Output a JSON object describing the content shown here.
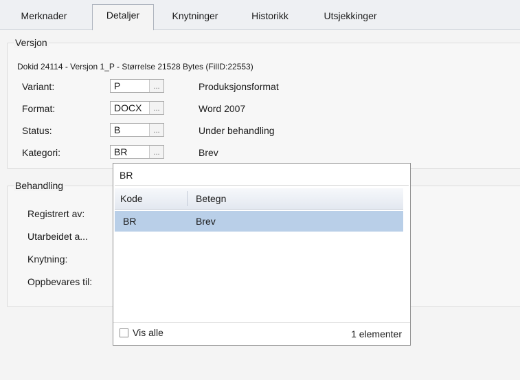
{
  "tabs": [
    {
      "label": "Merknader"
    },
    {
      "label": "Detaljer"
    },
    {
      "label": "Knytninger"
    },
    {
      "label": "Historikk"
    },
    {
      "label": "Utsjekkinger"
    }
  ],
  "versjon": {
    "title": "Versjon",
    "caption": "Dokid 24114 - Versjon 1_P - Størrelse 21528 Bytes (FilID:22553)",
    "fields": [
      {
        "label": "Variant:",
        "value": "P",
        "button": "...",
        "description": "Produksjonsformat"
      },
      {
        "label": "Format:",
        "value": "DOCX",
        "button": "...",
        "description": "Word 2007"
      },
      {
        "label": "Status:",
        "value": "B",
        "button": "...",
        "description": "Under behandling"
      },
      {
        "label": "Kategori:",
        "value": "BR",
        "button": "...",
        "description": "Brev"
      }
    ]
  },
  "behandling": {
    "title": "Behandling",
    "labels": [
      "Registrert av:",
      "Utarbeidet a...",
      "Knytning:",
      "Oppbevares til:"
    ]
  },
  "popup": {
    "search_value": "BR",
    "columns": [
      "Kode",
      "Betegn"
    ],
    "rows": [
      {
        "kode": "BR",
        "betegn": "Brev"
      }
    ],
    "show_all_label": "Vis alle",
    "show_all_checked": false,
    "count_label": "1 elementer"
  },
  "colors": {
    "selection": "#b9cfe8",
    "tab_bar": "#eef0f3"
  }
}
